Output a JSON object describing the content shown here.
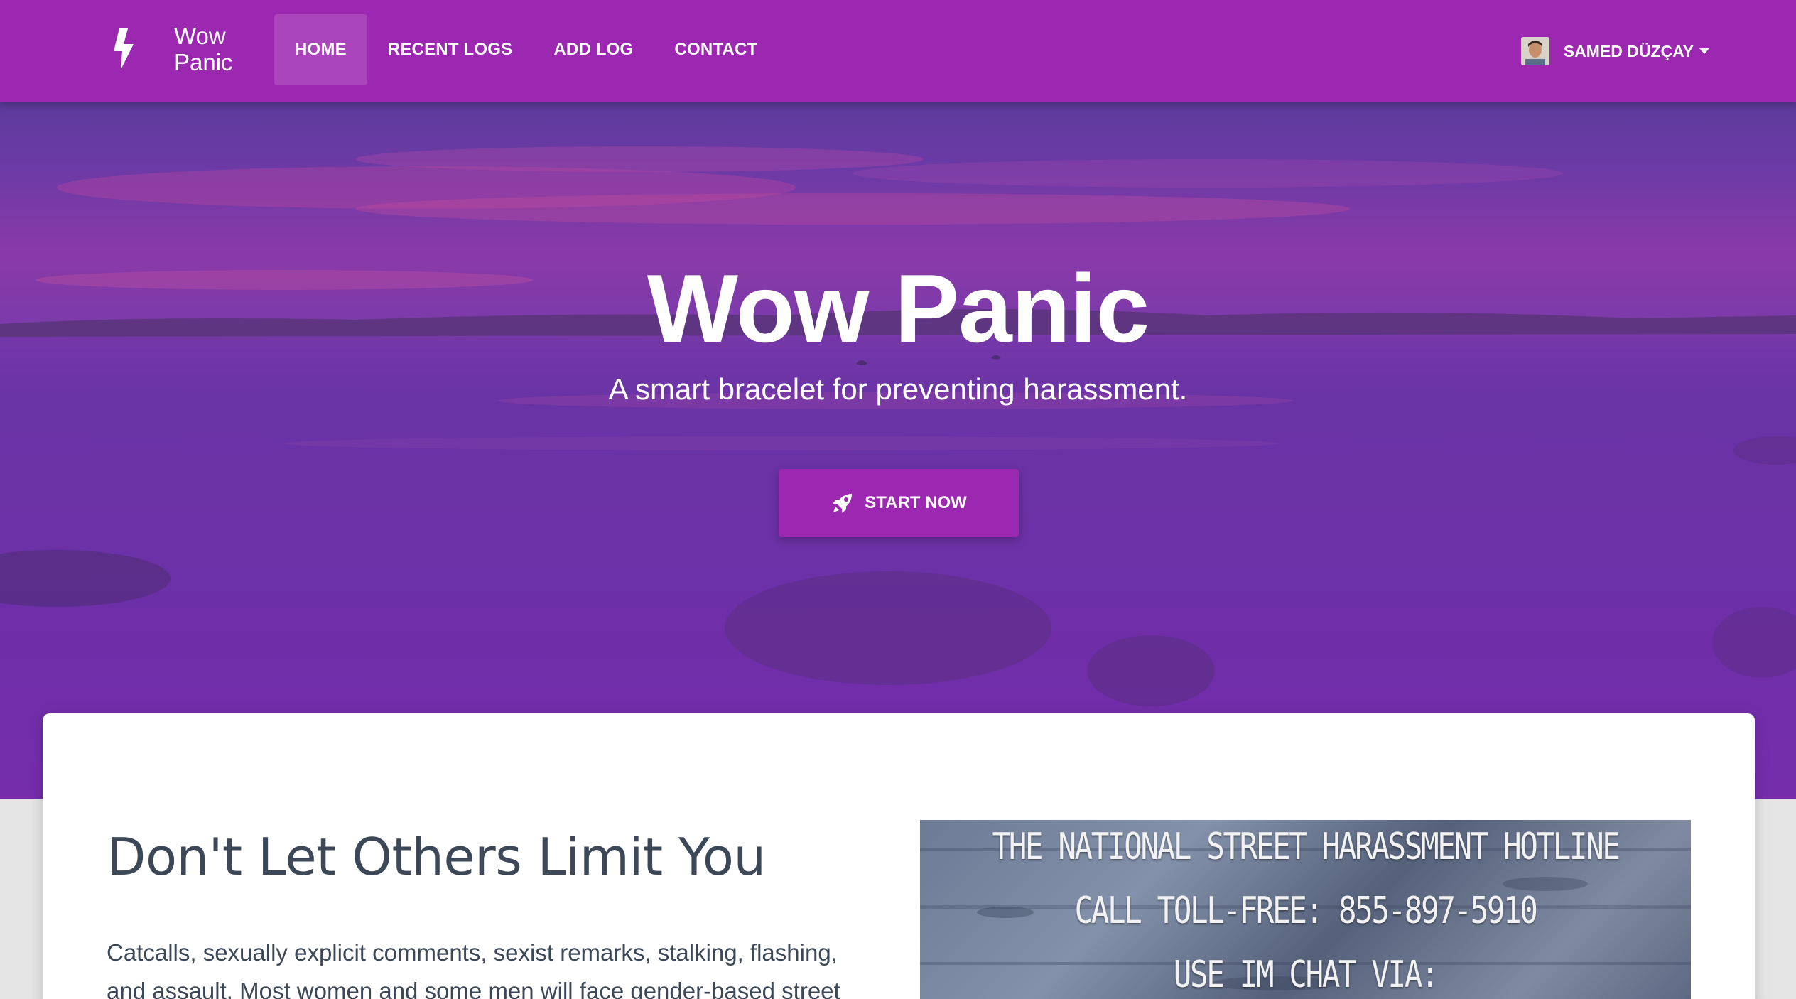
{
  "navbar": {
    "brand_name": "Wow Panic",
    "brand_line1": "Wow",
    "brand_line2": "Panic",
    "brand_icon": "lightning-bolt-icon",
    "links": [
      {
        "label": "HOME",
        "active": true
      },
      {
        "label": "RECENT LOGS",
        "active": false
      },
      {
        "label": "ADD LOG",
        "active": false
      },
      {
        "label": "CONTACT",
        "active": false
      }
    ],
    "user": {
      "name": "SAMED DÜZÇAY",
      "dropdown_icon": "caret-down-icon"
    }
  },
  "hero": {
    "title": "Wow Panic",
    "subtitle": "A smart bracelet for preventing harassment.",
    "cta_label": "START NOW",
    "cta_icon": "rocket-icon"
  },
  "content": {
    "heading": "Don't Let Others Limit You",
    "paragraph": "Catcalls, sexually explicit comments, sexist remarks, stalking, flashing, and assault. Most women and some men will face gender-based street",
    "hotline_image": {
      "line1": "THE NATIONAL STREET HARASSMENT HOTLINE",
      "line2": "CALL TOLL-FREE: 855-897-5910",
      "line3": "USE IM CHAT VIA: TINYURL.COM/THESHHOTLINE"
    }
  },
  "colors": {
    "primary": "#9c27b0",
    "text_dark": "#3c4858",
    "page_bg": "#e5e5e5"
  }
}
